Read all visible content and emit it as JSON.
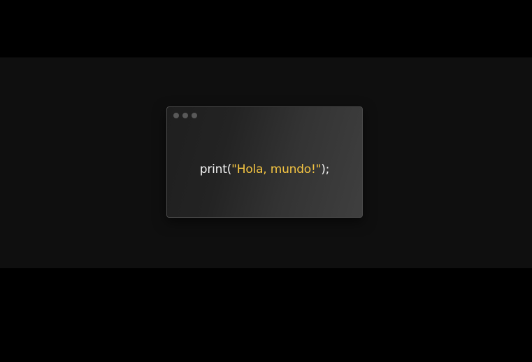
{
  "code_window": {
    "dots": [
      "close",
      "minimize",
      "maximize"
    ],
    "code": {
      "function": "print",
      "open": "(",
      "string": "\"Hola, mundo!\"",
      "close": ");"
    }
  },
  "colors": {
    "page_background": "#000000",
    "band_background": "#0f0f0f",
    "code_text": "#f2f2f2",
    "string_literal": "#f5c542",
    "window_dot": "#595959"
  }
}
